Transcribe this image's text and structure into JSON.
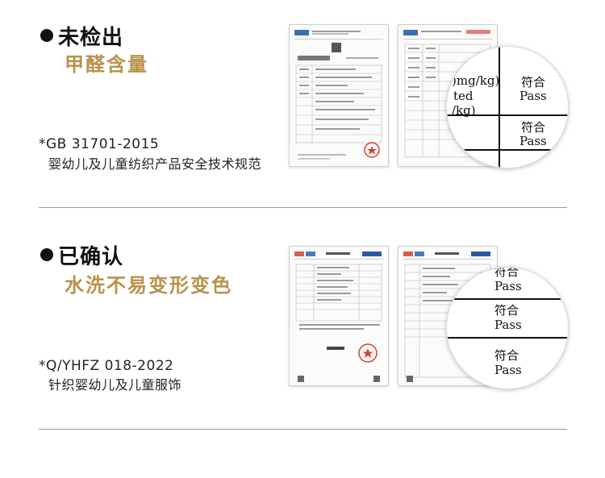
{
  "colors": {
    "accent": "#b8924a",
    "text": "#111111",
    "divider": "#9a9a9a",
    "seal": "#e03b2f"
  },
  "section1": {
    "heading": "未检出",
    "subheading": "甲醛含量",
    "standard_code": "*GB 31701-2015",
    "standard_name": "婴幼儿及儿童纺织产品安全技术规范",
    "zoom": {
      "unit_line1": ")mg/kg)",
      "unit_line2": "ted",
      "unit_line3": "/kg)",
      "result1_cn": "符合",
      "result1_en": "Pass",
      "result2_cn": "符合",
      "result2_en": "Pass"
    }
  },
  "section2": {
    "heading": "已确认",
    "subheading": "水洗不易变形变色",
    "standard_code": "*Q/YHFZ 018-2022",
    "standard_name": "针织婴幼儿及儿童服饰",
    "zoom": {
      "top_cut_cn": "符合",
      "result1_en": "Pass",
      "result2_cn": "符合",
      "result2_en": "Pass",
      "result3_cn": "符合",
      "result3_en": "Pass"
    }
  }
}
